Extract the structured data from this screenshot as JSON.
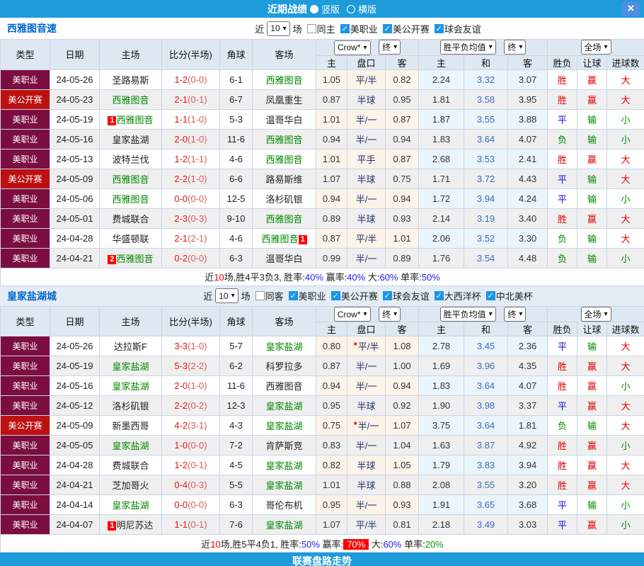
{
  "titlebar": {
    "title": "近期战绩",
    "radios": [
      {
        "label": "竖版",
        "selected": true
      },
      {
        "label": "横版",
        "selected": false
      }
    ],
    "close_label": "×"
  },
  "table_header": {
    "cols": [
      "类型",
      "日期",
      "主场",
      "比分(半场)",
      "角球",
      "客场"
    ],
    "sub": [
      "主",
      "盘口",
      "客",
      "主",
      "和",
      "客",
      "胜负",
      "让球",
      "进球数"
    ],
    "dd_odds": "Crow*",
    "dd_final": "终",
    "dd_avg": "胜平负均值",
    "dd_full": "全场"
  },
  "colors": {
    "bar_blue": "#1E9BD9",
    "close_blue": "#4D8FE0",
    "type_mls_bg": "#7B0D41",
    "type_usopen_bg": "#BD1111",
    "team_green": "#008800",
    "win_red": "#E00000",
    "draw_blue": "#1111DD",
    "lose_green": "#008800",
    "highlight_bg": "#FF0000",
    "checkbox_blue": "#1C95E8",
    "odds_col_bg": "#FCF3E9",
    "avg_col_bg": "#EAF4FB"
  },
  "sections": [
    {
      "team": "西雅图音速",
      "filter": {
        "prefix": "近",
        "count": "10",
        "suffix": "场",
        "same_label": "同主",
        "same_checked": false,
        "leagues": [
          "美职业",
          "美公开赛",
          "球会友谊"
        ]
      },
      "rows": [
        {
          "type": "美职业",
          "tc": "mls",
          "date": "24-05-26",
          "home": "圣路易斯",
          "hg": false,
          "hb": "",
          "score": "1-2",
          "half": "(0-0)",
          "corners": "6-1",
          "away": "西雅图音",
          "ag": true,
          "ab": "",
          "o1": "1.05",
          "hcp": "平/半",
          "star": false,
          "o2": "0.82",
          "a1": "2.24",
          "a2": "3.32",
          "a3": "3.07",
          "r1": {
            "t": "胜",
            "c": "r"
          },
          "r2": {
            "t": "赢",
            "c": "r"
          },
          "r3": {
            "t": "大",
            "c": "r"
          }
        },
        {
          "type": "美公开赛",
          "tc": "usoc",
          "date": "24-05-23",
          "home": "西雅图音",
          "hg": true,
          "hb": "",
          "score": "2-1",
          "half": "(0-1)",
          "corners": "6-7",
          "away": "凤凰重生",
          "ag": false,
          "ab": "",
          "o1": "0.87",
          "hcp": "半球",
          "star": false,
          "o2": "0.95",
          "a1": "1.81",
          "a2": "3.58",
          "a3": "3.95",
          "r1": {
            "t": "胜",
            "c": "r"
          },
          "r2": {
            "t": "赢",
            "c": "r"
          },
          "r3": {
            "t": "大",
            "c": "r"
          }
        },
        {
          "type": "美职业",
          "tc": "mls",
          "date": "24-05-19",
          "home": "西雅图音",
          "hg": true,
          "hb": "1",
          "score": "1-1",
          "half": "(1-0)",
          "corners": "5-3",
          "away": "温哥华白",
          "ag": false,
          "ab": "",
          "o1": "1.01",
          "hcp": "半/一",
          "star": false,
          "o2": "0.87",
          "a1": "1.87",
          "a2": "3.55",
          "a3": "3.88",
          "r1": {
            "t": "平",
            "c": "b"
          },
          "r2": {
            "t": "输",
            "c": "g"
          },
          "r3": {
            "t": "小",
            "c": "g"
          }
        },
        {
          "type": "美职业",
          "tc": "mls",
          "date": "24-05-16",
          "home": "皇家盐湖",
          "hg": false,
          "hb": "",
          "score": "2-0",
          "half": "(1-0)",
          "corners": "11-6",
          "away": "西雅图音",
          "ag": true,
          "ab": "",
          "o1": "0.94",
          "hcp": "半/一",
          "star": false,
          "o2": "0.94",
          "a1": "1.83",
          "a2": "3.64",
          "a3": "4.07",
          "r1": {
            "t": "负",
            "c": "g"
          },
          "r2": {
            "t": "输",
            "c": "g"
          },
          "r3": {
            "t": "小",
            "c": "g"
          }
        },
        {
          "type": "美职业",
          "tc": "mls",
          "date": "24-05-13",
          "home": "波特兰伐",
          "hg": false,
          "hb": "",
          "score": "1-2",
          "half": "(1-1)",
          "corners": "4-6",
          "away": "西雅图音",
          "ag": true,
          "ab": "",
          "o1": "1.01",
          "hcp": "平手",
          "star": false,
          "o2": "0.87",
          "a1": "2.68",
          "a2": "3.53",
          "a3": "2.41",
          "r1": {
            "t": "胜",
            "c": "r"
          },
          "r2": {
            "t": "赢",
            "c": "r"
          },
          "r3": {
            "t": "大",
            "c": "r"
          }
        },
        {
          "type": "美公开赛",
          "tc": "usoc",
          "date": "24-05-09",
          "home": "西雅图音",
          "hg": true,
          "hb": "",
          "score": "2-2",
          "half": "(1-0)",
          "corners": "6-6",
          "away": "路易斯维",
          "ag": false,
          "ab": "",
          "o1": "1.07",
          "hcp": "半球",
          "star": false,
          "o2": "0.75",
          "a1": "1.71",
          "a2": "3.72",
          "a3": "4.43",
          "r1": {
            "t": "平",
            "c": "b"
          },
          "r2": {
            "t": "输",
            "c": "g"
          },
          "r3": {
            "t": "大",
            "c": "r"
          }
        },
        {
          "type": "美职业",
          "tc": "mls",
          "date": "24-05-06",
          "home": "西雅图音",
          "hg": true,
          "hb": "",
          "score": "0-0",
          "half": "(0-0)",
          "corners": "12-5",
          "away": "洛杉矶银",
          "ag": false,
          "ab": "",
          "o1": "0.94",
          "hcp": "半/一",
          "star": false,
          "o2": "0.94",
          "a1": "1.72",
          "a2": "3.94",
          "a3": "4.24",
          "r1": {
            "t": "平",
            "c": "b"
          },
          "r2": {
            "t": "输",
            "c": "g"
          },
          "r3": {
            "t": "小",
            "c": "g"
          }
        },
        {
          "type": "美职业",
          "tc": "mls",
          "date": "24-05-01",
          "home": "费城联合",
          "hg": false,
          "hb": "",
          "score": "2-3",
          "half": "(0-3)",
          "corners": "9-10",
          "away": "西雅图音",
          "ag": true,
          "ab": "",
          "o1": "0.89",
          "hcp": "半球",
          "star": false,
          "o2": "0.93",
          "a1": "2.14",
          "a2": "3.19",
          "a3": "3.40",
          "r1": {
            "t": "胜",
            "c": "r"
          },
          "r2": {
            "t": "赢",
            "c": "r"
          },
          "r3": {
            "t": "大",
            "c": "r"
          }
        },
        {
          "type": "美职业",
          "tc": "mls",
          "date": "24-04-28",
          "home": "华盛顿联",
          "hg": false,
          "hb": "",
          "score": "2-1",
          "half": "(2-1)",
          "corners": "4-6",
          "away": "西雅图音",
          "ag": true,
          "ab": "1",
          "o1": "0.87",
          "hcp": "平/半",
          "star": false,
          "o2": "1.01",
          "a1": "2.06",
          "a2": "3.52",
          "a3": "3.30",
          "r1": {
            "t": "负",
            "c": "g"
          },
          "r2": {
            "t": "输",
            "c": "g"
          },
          "r3": {
            "t": "大",
            "c": "r"
          }
        },
        {
          "type": "美职业",
          "tc": "mls",
          "date": "24-04-21",
          "home": "西雅图音",
          "hg": true,
          "hb": "2",
          "score": "0-2",
          "half": "(0-0)",
          "corners": "6-3",
          "away": "温哥华白",
          "ag": false,
          "ab": "",
          "o1": "0.99",
          "hcp": "半/一",
          "star": false,
          "o2": "0.89",
          "a1": "1.76",
          "a2": "3.54",
          "a3": "4.48",
          "r1": {
            "t": "负",
            "c": "g"
          },
          "r2": {
            "t": "输",
            "c": "g"
          },
          "r3": {
            "t": "小",
            "c": "g"
          }
        }
      ],
      "summary": [
        {
          "t": "近",
          "c": "k"
        },
        {
          "t": "10",
          "c": "r"
        },
        {
          "t": "场,胜4平3负3, 胜率:",
          "c": "k"
        },
        {
          "t": "40%",
          "c": "b"
        },
        {
          "t": " 赢率:",
          "c": "k"
        },
        {
          "t": "40%",
          "c": "b"
        },
        {
          "t": " 大:",
          "c": "k"
        },
        {
          "t": "60%",
          "c": "b"
        },
        {
          "t": " 单率:",
          "c": "k"
        },
        {
          "t": "50%",
          "c": "b"
        }
      ]
    },
    {
      "team": "皇家盐湖城",
      "filter": {
        "prefix": "近",
        "count": "10",
        "suffix": "场",
        "same_label": "同客",
        "same_checked": false,
        "leagues": [
          "美职业",
          "美公开赛",
          "球会友谊",
          "大西洋杯",
          "中北美杯"
        ]
      },
      "rows": [
        {
          "type": "美职业",
          "tc": "mls",
          "date": "24-05-26",
          "home": "达拉斯F",
          "hg": false,
          "hb": "",
          "score": "3-3",
          "half": "(1-0)",
          "corners": "5-7",
          "away": "皇家盐湖",
          "ag": true,
          "ab": "",
          "o1": "0.80",
          "hcp": "平/半",
          "star": true,
          "o2": "1.08",
          "a1": "2.78",
          "a2": "3.45",
          "a3": "2.36",
          "r1": {
            "t": "平",
            "c": "b"
          },
          "r2": {
            "t": "输",
            "c": "g"
          },
          "r3": {
            "t": "大",
            "c": "r"
          }
        },
        {
          "type": "美职业",
          "tc": "mls",
          "date": "24-05-19",
          "home": "皇家盐湖",
          "hg": true,
          "hb": "",
          "score": "5-3",
          "half": "(2-2)",
          "corners": "6-2",
          "away": "科罗拉多",
          "ag": false,
          "ab": "",
          "o1": "0.87",
          "hcp": "半/一",
          "star": false,
          "o2": "1.00",
          "a1": "1.69",
          "a2": "3.96",
          "a3": "4.35",
          "r1": {
            "t": "胜",
            "c": "r"
          },
          "r2": {
            "t": "赢",
            "c": "r"
          },
          "r3": {
            "t": "大",
            "c": "r"
          }
        },
        {
          "type": "美职业",
          "tc": "mls",
          "date": "24-05-16",
          "home": "皇家盐湖",
          "hg": true,
          "hb": "",
          "score": "2-0",
          "half": "(1-0)",
          "corners": "11-6",
          "away": "西雅图音",
          "ag": false,
          "ab": "",
          "o1": "0.94",
          "hcp": "半/一",
          "star": false,
          "o2": "0.94",
          "a1": "1.83",
          "a2": "3.64",
          "a3": "4.07",
          "r1": {
            "t": "胜",
            "c": "r"
          },
          "r2": {
            "t": "赢",
            "c": "r"
          },
          "r3": {
            "t": "小",
            "c": "g"
          }
        },
        {
          "type": "美职业",
          "tc": "mls",
          "date": "24-05-12",
          "home": "洛杉矶银",
          "hg": false,
          "hb": "",
          "score": "2-2",
          "half": "(0-2)",
          "corners": "12-3",
          "away": "皇家盐湖",
          "ag": true,
          "ab": "",
          "o1": "0.95",
          "hcp": "半球",
          "star": false,
          "o2": "0.92",
          "a1": "1.90",
          "a2": "3.98",
          "a3": "3.37",
          "r1": {
            "t": "平",
            "c": "b"
          },
          "r2": {
            "t": "赢",
            "c": "r"
          },
          "r3": {
            "t": "大",
            "c": "r"
          }
        },
        {
          "type": "美公开赛",
          "tc": "usoc",
          "date": "24-05-09",
          "home": "新墨西哥",
          "hg": false,
          "hb": "",
          "score": "4-2",
          "half": "(3-1)",
          "corners": "4-3",
          "away": "皇家盐湖",
          "ag": true,
          "ab": "",
          "o1": "0.75",
          "hcp": "半/一",
          "star": true,
          "o2": "1.07",
          "a1": "3.75",
          "a2": "3.64",
          "a3": "1.81",
          "r1": {
            "t": "负",
            "c": "g"
          },
          "r2": {
            "t": "输",
            "c": "g"
          },
          "r3": {
            "t": "大",
            "c": "r"
          }
        },
        {
          "type": "美职业",
          "tc": "mls",
          "date": "24-05-05",
          "home": "皇家盐湖",
          "hg": true,
          "hb": "",
          "score": "1-0",
          "half": "(0-0)",
          "corners": "7-2",
          "away": "肯萨斯竞",
          "ag": false,
          "ab": "",
          "o1": "0.83",
          "hcp": "半/一",
          "star": false,
          "o2": "1.04",
          "a1": "1.63",
          "a2": "3.87",
          "a3": "4.92",
          "r1": {
            "t": "胜",
            "c": "r"
          },
          "r2": {
            "t": "赢",
            "c": "r"
          },
          "r3": {
            "t": "小",
            "c": "g"
          }
        },
        {
          "type": "美职业",
          "tc": "mls",
          "date": "24-04-28",
          "home": "费城联合",
          "hg": false,
          "hb": "",
          "score": "1-2",
          "half": "(0-1)",
          "corners": "4-5",
          "away": "皇家盐湖",
          "ag": true,
          "ab": "",
          "o1": "0.82",
          "hcp": "半球",
          "star": false,
          "o2": "1.05",
          "a1": "1.79",
          "a2": "3.83",
          "a3": "3.94",
          "r1": {
            "t": "胜",
            "c": "r"
          },
          "r2": {
            "t": "赢",
            "c": "r"
          },
          "r3": {
            "t": "大",
            "c": "r"
          }
        },
        {
          "type": "美职业",
          "tc": "mls",
          "date": "24-04-21",
          "home": "芝加哥火",
          "hg": false,
          "hb": "",
          "score": "0-4",
          "half": "(0-3)",
          "corners": "5-5",
          "away": "皇家盐湖",
          "ag": true,
          "ab": "",
          "o1": "1.01",
          "hcp": "半球",
          "star": false,
          "o2": "0.88",
          "a1": "2.08",
          "a2": "3.55",
          "a3": "3.20",
          "r1": {
            "t": "胜",
            "c": "r"
          },
          "r2": {
            "t": "赢",
            "c": "r"
          },
          "r3": {
            "t": "大",
            "c": "r"
          }
        },
        {
          "type": "美职业",
          "tc": "mls",
          "date": "24-04-14",
          "home": "皇家盐湖",
          "hg": true,
          "hb": "",
          "score": "0-0",
          "half": "(0-0)",
          "corners": "6-3",
          "away": "哥伦布机",
          "ag": false,
          "ab": "",
          "o1": "0.95",
          "hcp": "半/一",
          "star": false,
          "o2": "0.93",
          "a1": "1.91",
          "a2": "3.65",
          "a3": "3.68",
          "r1": {
            "t": "平",
            "c": "b"
          },
          "r2": {
            "t": "输",
            "c": "g"
          },
          "r3": {
            "t": "小",
            "c": "g"
          }
        },
        {
          "type": "美职业",
          "tc": "mls",
          "date": "24-04-07",
          "home": "明尼苏达",
          "hg": false,
          "hb": "1",
          "score": "1-1",
          "half": "(0-1)",
          "corners": "7-6",
          "away": "皇家盐湖",
          "ag": true,
          "ab": "",
          "o1": "1.07",
          "hcp": "平/半",
          "star": false,
          "o2": "0.81",
          "a1": "2.18",
          "a2": "3.49",
          "a3": "3.03",
          "r1": {
            "t": "平",
            "c": "b"
          },
          "r2": {
            "t": "赢",
            "c": "r"
          },
          "r3": {
            "t": "小",
            "c": "g"
          }
        }
      ],
      "summary": [
        {
          "t": "近",
          "c": "k"
        },
        {
          "t": "10",
          "c": "r"
        },
        {
          "t": "场,胜5平4负1, 胜率:",
          "c": "k"
        },
        {
          "t": "50%",
          "c": "b"
        },
        {
          "t": " 赢率:",
          "c": "k"
        },
        {
          "t": "70%",
          "c": "hl"
        },
        {
          "t": " 大:",
          "c": "k"
        },
        {
          "t": "60%",
          "c": "b"
        },
        {
          "t": " 单率:",
          "c": "k"
        },
        {
          "t": "20%",
          "c": "g"
        }
      ]
    }
  ],
  "footer": {
    "label": "联赛盘路走势"
  }
}
